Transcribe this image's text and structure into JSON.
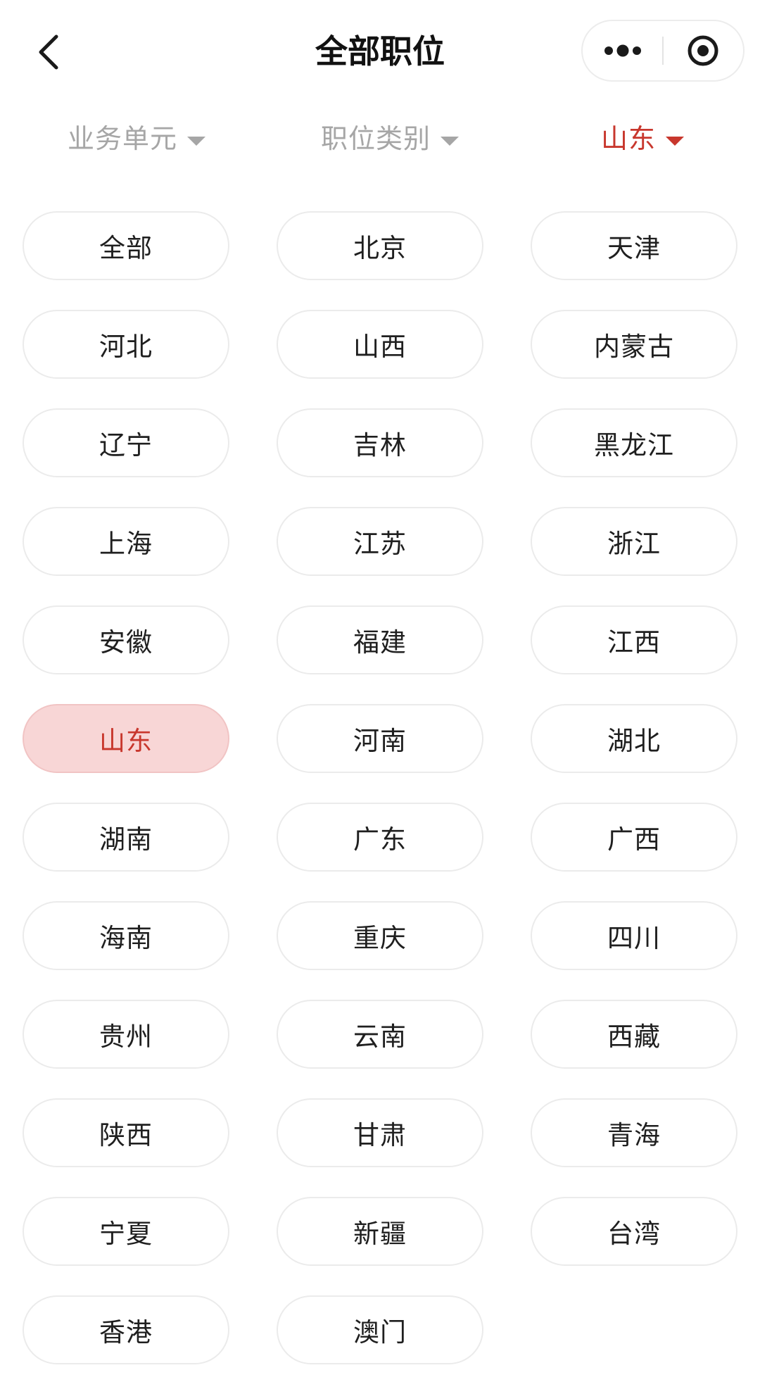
{
  "header": {
    "title": "全部职位"
  },
  "filters": [
    {
      "label": "业务单元",
      "active": false
    },
    {
      "label": "职位类别",
      "active": false
    },
    {
      "label": "山东",
      "active": true
    }
  ],
  "regions": [
    "全部",
    "北京",
    "天津",
    "河北",
    "山西",
    "内蒙古",
    "辽宁",
    "吉林",
    "黑龙江",
    "上海",
    "江苏",
    "浙江",
    "安徽",
    "福建",
    "江西",
    "山东",
    "河南",
    "湖北",
    "湖南",
    "广东",
    "广西",
    "海南",
    "重庆",
    "四川",
    "贵州",
    "云南",
    "西藏",
    "陕西",
    "甘肃",
    "青海",
    "宁夏",
    "新疆",
    "台湾",
    "香港",
    "澳门"
  ],
  "selected_region": "山东",
  "colors": {
    "accent": "#c8372d",
    "selected_bg": "#f8d6d6",
    "inactive_filter": "#a6a6a6",
    "chip_border": "#ebebeb"
  },
  "icons": {
    "back": "chevron-left-icon",
    "more": "more-dots-icon",
    "close": "target-circle-icon",
    "dropdown": "caret-down-icon"
  }
}
